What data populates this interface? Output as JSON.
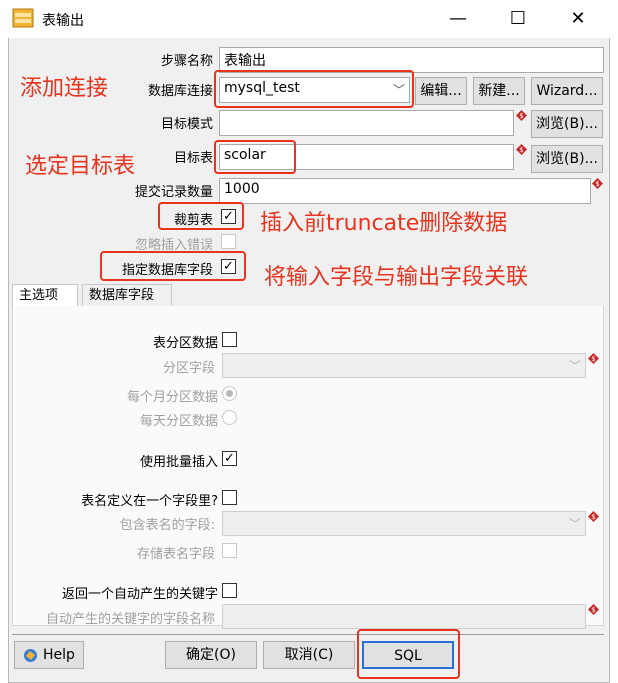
{
  "window": {
    "title": "表输出",
    "minimize_glyph": "—",
    "maximize_glyph": "☐",
    "close_glyph": "✕"
  },
  "form": {
    "step_name": {
      "label": "步骤名称",
      "value": "表输出"
    },
    "connection": {
      "label": "数据库连接",
      "value": "mysql_test",
      "edit_label": "编辑...",
      "new_label": "新建...",
      "wizard_label": "Wizard..."
    },
    "target_schema": {
      "label": "目标模式",
      "value": "",
      "browse_label": "浏览(B)..."
    },
    "target_table": {
      "label": "目标表",
      "value": "scolar",
      "browse_label": "浏览(B)..."
    },
    "commit_size": {
      "label": "提交记录数量",
      "value": "1000"
    },
    "truncate": {
      "label": "裁剪表",
      "checked": true
    },
    "ignore_errors": {
      "label": "忽略插入错误",
      "checked": false
    },
    "specify_fields": {
      "label": "指定数据库字段",
      "checked": true
    }
  },
  "annotations": {
    "add_connection": "添加连接",
    "select_table": "选定目标表",
    "truncate_note": "插入前truncate删除数据",
    "map_fields_note": "将输入字段与输出字段关联"
  },
  "tabs": [
    {
      "label": "主选项",
      "active": true
    },
    {
      "label": "数据库字段",
      "active": false
    }
  ],
  "main_options": {
    "partition_data": {
      "label": "表分区数据",
      "checked": false
    },
    "partition_field": {
      "label": "分区字段",
      "value": ""
    },
    "partition_monthly": {
      "label": "每个月分区数据",
      "selected": true
    },
    "partition_daily": {
      "label": "每天分区数据",
      "selected": false
    },
    "batch_insert": {
      "label": "使用批量插入",
      "checked": true
    },
    "table_name_in_field": {
      "label": "表名定义在一个字段里?",
      "checked": false
    },
    "table_name_field": {
      "label": "包含表名的字段:",
      "value": ""
    },
    "store_table_name": {
      "label": "存储表名字段",
      "checked": false
    },
    "return_key": {
      "label": "返回一个自动产生的关键字",
      "checked": false
    },
    "key_field_name": {
      "label": "自动产生的关键字的字段名称",
      "value": ""
    }
  },
  "footer": {
    "help_label": "Help",
    "ok_label": "确定(O)",
    "cancel_label": "取消(C)",
    "sql_label": "SQL"
  },
  "colors": {
    "annotation_red": "#e8331f",
    "window_bg": "#f0f0f0"
  }
}
